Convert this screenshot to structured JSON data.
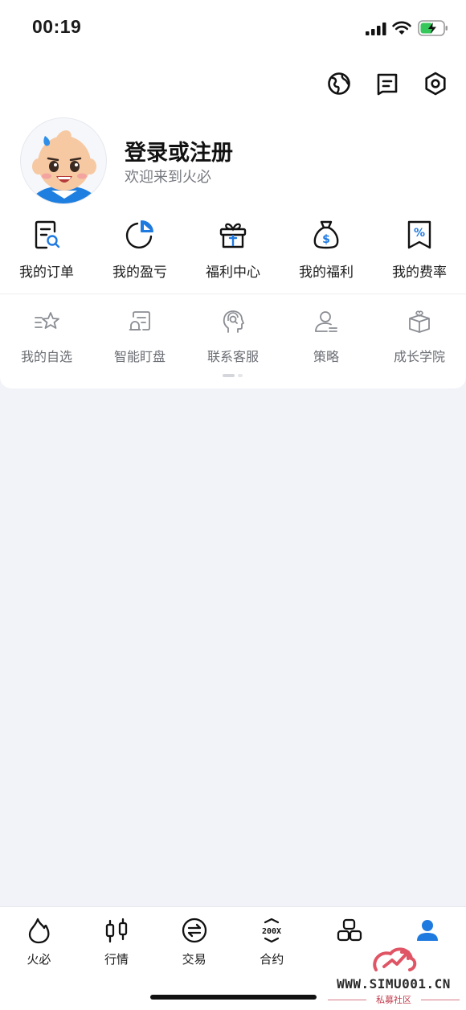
{
  "status_bar": {
    "time": "00:19"
  },
  "header": {
    "icons": [
      "globe-icon",
      "message-icon",
      "settings-icon"
    ]
  },
  "profile": {
    "title": "登录或注册",
    "subtitle": "欢迎来到火必"
  },
  "primary_menu": [
    {
      "label": "我的订单",
      "icon": "order-search-icon"
    },
    {
      "label": "我的盈亏",
      "icon": "pie-chart-icon"
    },
    {
      "label": "福利中心",
      "icon": "gift-icon"
    },
    {
      "label": "我的福利",
      "icon": "money-bag-icon"
    },
    {
      "label": "我的费率",
      "icon": "percent-tag-icon"
    }
  ],
  "secondary_menu": [
    {
      "label": "我的自选",
      "icon": "star-list-icon"
    },
    {
      "label": "智能盯盘",
      "icon": "monitor-icon"
    },
    {
      "label": "联系客服",
      "icon": "headset-icon"
    },
    {
      "label": "策略",
      "icon": "user-strategy-icon"
    },
    {
      "label": "成长学院",
      "icon": "book-icon"
    }
  ],
  "bottom_nav": {
    "active_index": 5,
    "tabs": [
      {
        "label": "火必",
        "icon": "flame-icon"
      },
      {
        "label": "行情",
        "icon": "candlestick-icon"
      },
      {
        "label": "交易",
        "icon": "exchange-icon"
      },
      {
        "label": "合约",
        "icon": "contract-200x-icon"
      },
      {
        "label": "",
        "icon": "assets-icon"
      },
      {
        "label": "",
        "icon": "profile-icon"
      }
    ]
  },
  "watermark": {
    "text": "WWW.SIMU001.CN",
    "subtext": "私募社区"
  },
  "colors": {
    "accent": "#1f7ae0",
    "background": "#f2f3f8",
    "card": "#ffffff",
    "text": "#1a1a1a",
    "muted": "#6a6d73"
  }
}
